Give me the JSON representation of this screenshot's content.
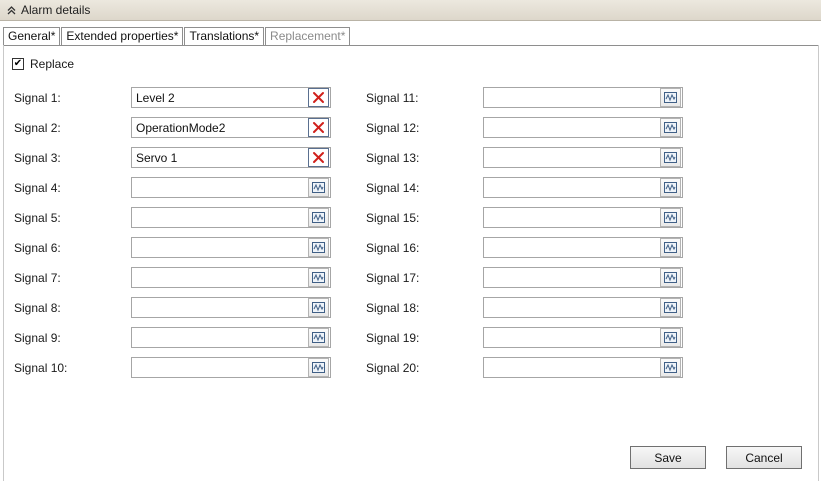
{
  "header": {
    "title": "Alarm details",
    "collapse_icon": "double-chevron-up-icon"
  },
  "tabs": [
    {
      "label": "General*",
      "active": false
    },
    {
      "label": "Extended properties*",
      "active": false
    },
    {
      "label": "Translations*",
      "active": false
    },
    {
      "label": "Replacement*",
      "active": true
    }
  ],
  "replace": {
    "label": "Replace",
    "checked": true,
    "check_glyph": "✔"
  },
  "signals_left": [
    {
      "label": "Signal 1:",
      "value": "Level 2",
      "action": "clear"
    },
    {
      "label": "Signal 2:",
      "value": "OperationMode2",
      "action": "clear"
    },
    {
      "label": "Signal 3:",
      "value": "Servo 1",
      "action": "clear"
    },
    {
      "label": "Signal 4:",
      "value": "",
      "action": "browse"
    },
    {
      "label": "Signal 5:",
      "value": "",
      "action": "browse"
    },
    {
      "label": "Signal 6:",
      "value": "",
      "action": "browse"
    },
    {
      "label": "Signal 7:",
      "value": "",
      "action": "browse"
    },
    {
      "label": "Signal 8:",
      "value": "",
      "action": "browse"
    },
    {
      "label": "Signal 9:",
      "value": "",
      "action": "browse"
    },
    {
      "label": "Signal 10:",
      "value": "",
      "action": "browse"
    }
  ],
  "signals_right": [
    {
      "label": "Signal 11:",
      "value": "",
      "action": "browse"
    },
    {
      "label": "Signal 12:",
      "value": "",
      "action": "browse"
    },
    {
      "label": "Signal 13:",
      "value": "",
      "action": "browse"
    },
    {
      "label": "Signal 14:",
      "value": "",
      "action": "browse"
    },
    {
      "label": "Signal 15:",
      "value": "",
      "action": "browse"
    },
    {
      "label": "Signal 16:",
      "value": "",
      "action": "browse"
    },
    {
      "label": "Signal 17:",
      "value": "",
      "action": "browse"
    },
    {
      "label": "Signal 18:",
      "value": "",
      "action": "browse"
    },
    {
      "label": "Signal 19:",
      "value": "",
      "action": "browse"
    },
    {
      "label": "Signal 20:",
      "value": "",
      "action": "browse"
    }
  ],
  "icons": {
    "clear": "clear-x-icon",
    "browse": "signal-browse-icon"
  },
  "colors": {
    "clear_x": "#d0201b",
    "browse_icon": "#3f5f86"
  },
  "footer": {
    "save_label": "Save",
    "cancel_label": "Cancel"
  }
}
